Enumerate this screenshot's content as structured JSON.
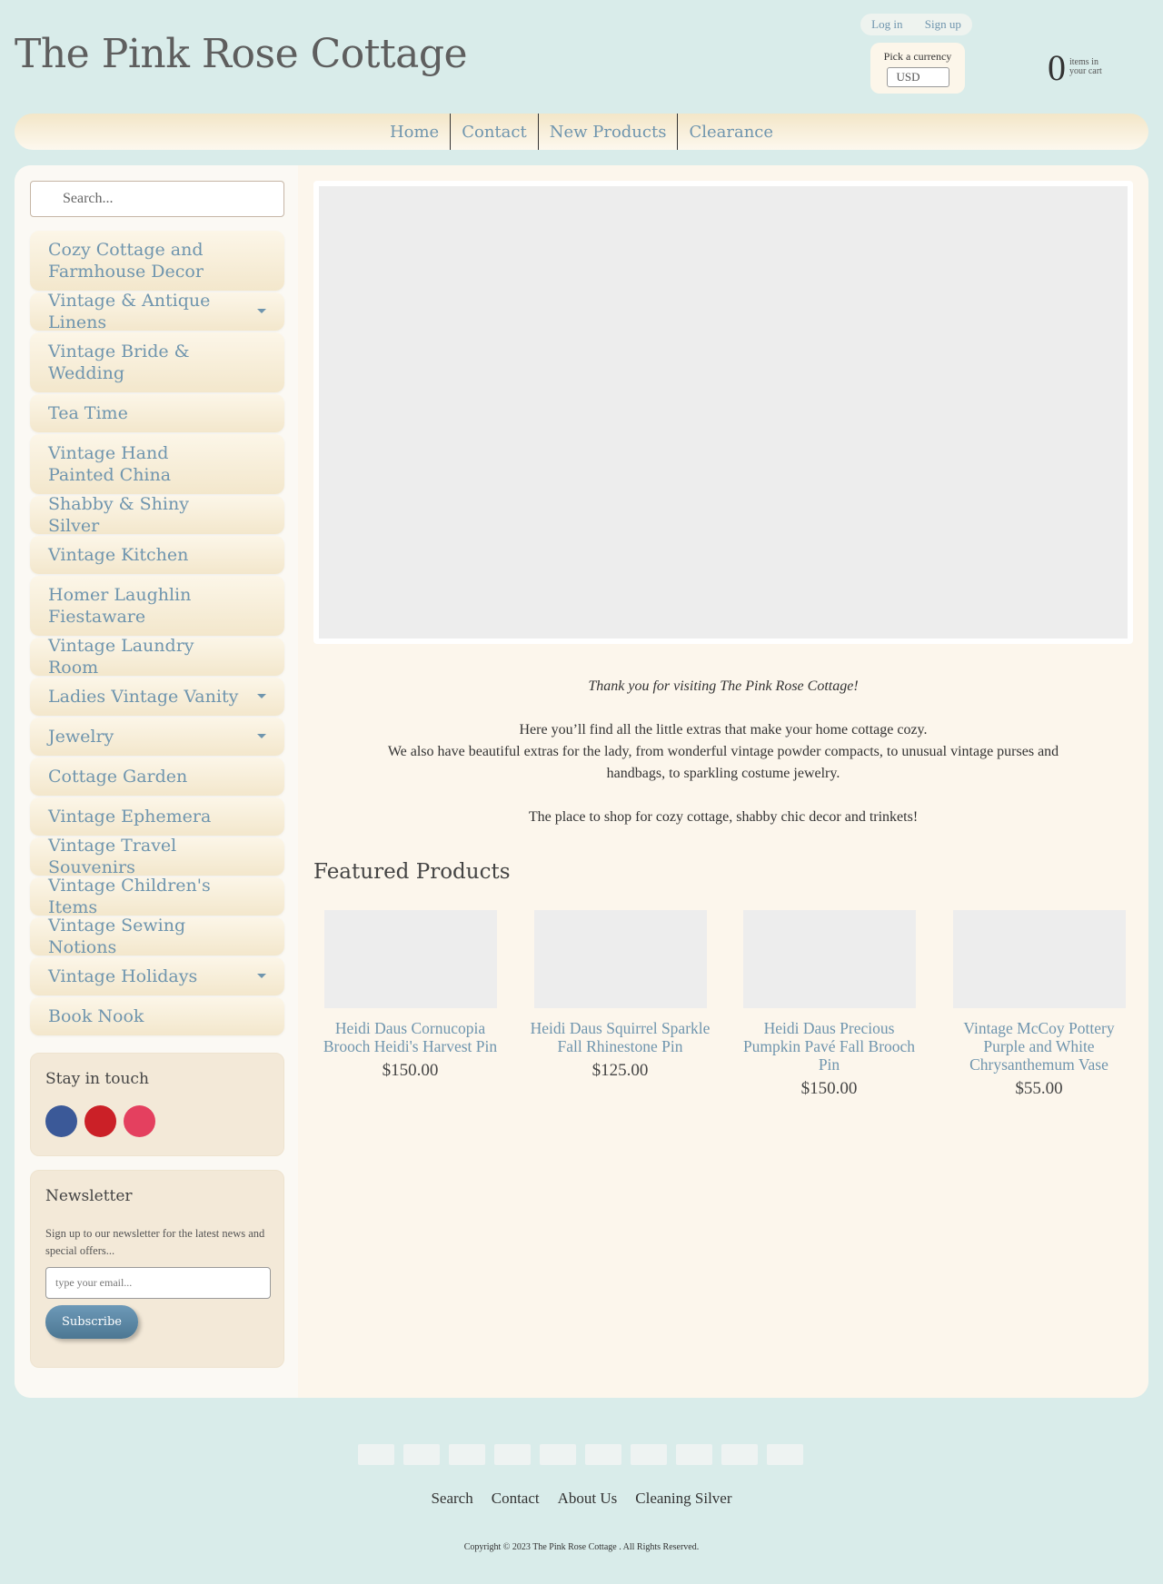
{
  "header": {
    "site_title": "The Pink Rose Cottage",
    "login": "Log in",
    "signup": "Sign up",
    "currency_label": "Pick a currency",
    "currency_value": "USD",
    "cart_count": "0",
    "cart_label": "items in your cart"
  },
  "nav": [
    "Home",
    "Contact",
    "New Products",
    "Clearance"
  ],
  "sidebar": {
    "search_placeholder": "Search...",
    "categories": [
      {
        "label": "Cozy Cottage and Farmhouse Decor",
        "has_submenu": false
      },
      {
        "label": "Vintage & Antique Linens",
        "has_submenu": true
      },
      {
        "label": "Vintage Bride & Wedding",
        "has_submenu": false
      },
      {
        "label": "Tea Time",
        "has_submenu": false
      },
      {
        "label": "Vintage Hand Painted China",
        "has_submenu": false
      },
      {
        "label": "Shabby & Shiny Silver",
        "has_submenu": false
      },
      {
        "label": "Vintage Kitchen",
        "has_submenu": false
      },
      {
        "label": "Homer Laughlin Fiestaware",
        "has_submenu": false
      },
      {
        "label": "Vintage Laundry Room",
        "has_submenu": false
      },
      {
        "label": "Ladies Vintage Vanity",
        "has_submenu": true
      },
      {
        "label": "Jewelry",
        "has_submenu": true
      },
      {
        "label": "Cottage Garden",
        "has_submenu": false
      },
      {
        "label": "Vintage Ephemera",
        "has_submenu": false
      },
      {
        "label": "Vintage Travel Souvenirs",
        "has_submenu": false
      },
      {
        "label": "Vintage Children's Items",
        "has_submenu": false
      },
      {
        "label": "Vintage Sewing Notions",
        "has_submenu": false
      },
      {
        "label": "Vintage Holidays",
        "has_submenu": true
      },
      {
        "label": "Book Nook",
        "has_submenu": false
      }
    ],
    "stay_in_touch": {
      "title": "Stay in touch",
      "icons": [
        {
          "name": "facebook-icon",
          "color": "#3b5998"
        },
        {
          "name": "pinterest-icon",
          "color": "#cb2027"
        },
        {
          "name": "instagram-icon",
          "color": "#e4405f"
        }
      ]
    },
    "newsletter": {
      "title": "Newsletter",
      "text": "Sign up to our newsletter for the latest news and special offers...",
      "email_placeholder": "type your email...",
      "button": "Subscribe"
    }
  },
  "main": {
    "welcome_italic": "Thank you for visiting The Pink Rose Cottage!",
    "welcome_line1": "Here you’ll find all the little extras that make your home cottage cozy.",
    "welcome_line2": "We also have beautiful extras for the lady, from wonderful vintage powder compacts, to unusual vintage purses and handbags, to sparkling costume jewelry.",
    "welcome_line3": "The place to shop for cozy cottage, shabby chic decor and trinkets!",
    "featured_title": "Featured Products",
    "products": [
      {
        "name": "Heidi Daus Cornucopia Brooch Heidi's Harvest Pin",
        "price": "$150.00"
      },
      {
        "name": "Heidi Daus Squirrel Sparkle Fall Rhinestone Pin",
        "price": "$125.00"
      },
      {
        "name": "Heidi Daus Precious Pumpkin Pavé Fall Brooch Pin",
        "price": "$150.00"
      },
      {
        "name": "Vintage McCoy Pottery Purple and White Chrysanthemum Vase",
        "price": "$55.00"
      }
    ]
  },
  "footer": {
    "links": [
      "Search",
      "Contact",
      "About Us",
      "Cleaning Silver"
    ],
    "copyright": "Copyright © 2023 The Pink Rose Cottage . All Rights Reserved."
  },
  "colors": {
    "background": "#d9ecea",
    "link": "#6f95ae",
    "panel": "#fcf6ec"
  }
}
